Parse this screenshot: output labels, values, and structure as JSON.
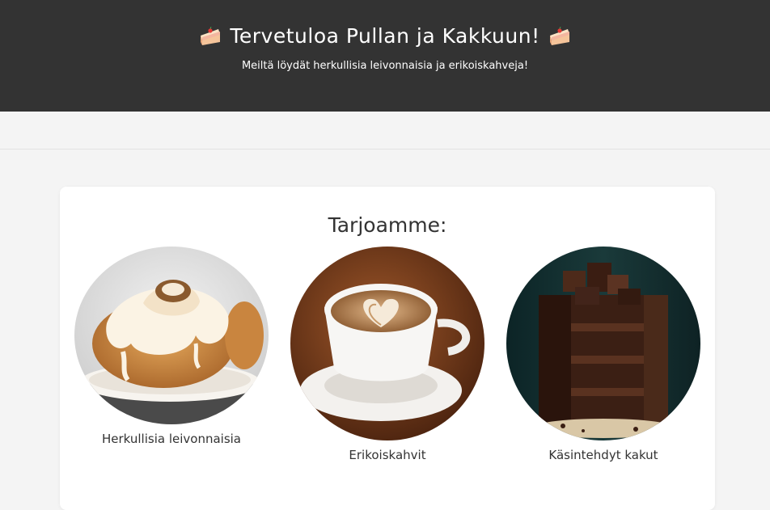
{
  "header": {
    "title": "Tervetuloa Pullan ja Kakkuun!",
    "subtitle": "Meiltä löydät herkullisia leivonnaisia ja erikoiskahveja!",
    "icon": "cake-slice-icon",
    "background": "#333333",
    "text_color": "#ffffff"
  },
  "main": {
    "section_title": "Tarjoamme:",
    "offers": [
      {
        "label": "Herkullisia leivonnaisia",
        "image": "cinnamon-roll-image"
      },
      {
        "label": "Erikoiskahvit",
        "image": "latte-coffee-image"
      },
      {
        "label": "Käsintehdyt kakut",
        "image": "chocolate-cake-image"
      }
    ]
  }
}
